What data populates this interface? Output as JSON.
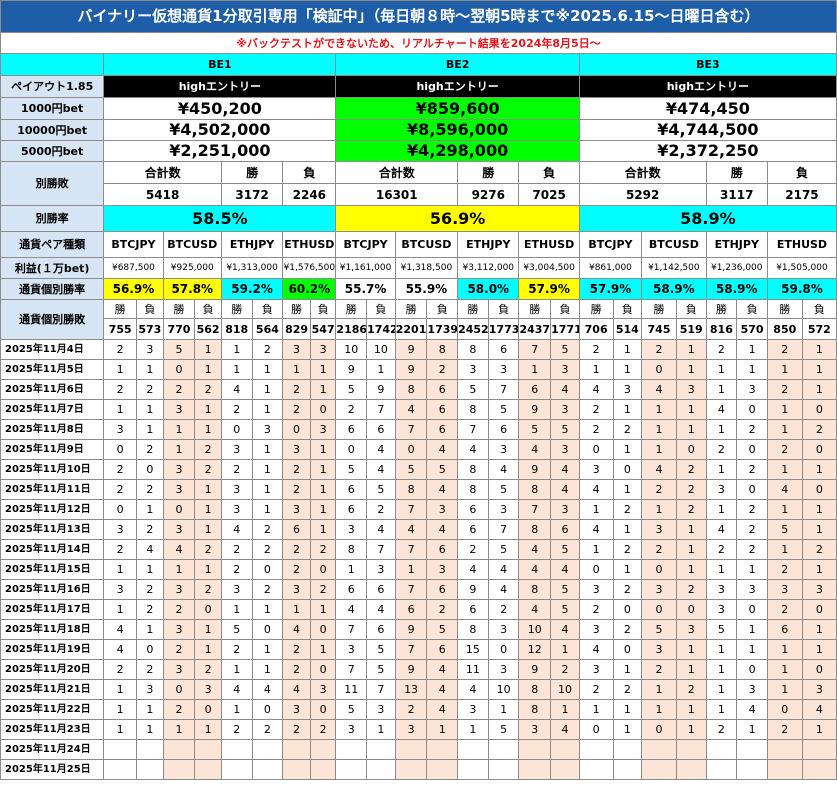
{
  "title": "バイナリー仮想通貨1分取引専用「検証中」（毎日朝８時〜翌朝5時まで※2025.6.15〜日曜日含む）",
  "subtitle": "※バックテストができないため、リアルチャート結果を2024年8月5日〜",
  "payout_label": "ペイアウト1.85",
  "colors": {
    "title_bg": "#1e5ea8",
    "cyan": "#00ffff",
    "green": "#00ff00",
    "yellow": "#ffff00",
    "pink": "#fce4d6",
    "label_bg": "#d7e4f4",
    "subtitle_text": "#e8141b"
  },
  "groups": [
    {
      "name": "BE1",
      "entry": "highエントリー",
      "bet_1000": "¥450,200",
      "bet_10000": "¥4,502,000",
      "bet_5000": "¥2,251,000",
      "total_label": "合計数",
      "win_label": "勝",
      "loss_label": "負",
      "total": "5418",
      "wins": "3172",
      "losses": "2246",
      "rate": "58.5%",
      "pairs": [
        {
          "name": "BTCJPY",
          "profit": "¥687,500",
          "rate": "56.9%",
          "w": "755",
          "l": "573"
        },
        {
          "name": "BTCUSD",
          "profit": "¥925,000",
          "rate": "57.8%",
          "w": "770",
          "l": "562"
        },
        {
          "name": "ETHJPY",
          "profit": "¥1,313,000",
          "rate": "59.2%",
          "w": "818",
          "l": "564"
        },
        {
          "name": "ETHUSD",
          "profit": "¥1,576,500",
          "rate": "60.2%",
          "w": "829",
          "l": "547"
        }
      ]
    },
    {
      "name": "BE2",
      "entry": "highエントリー",
      "bet_1000": "¥859,600",
      "bet_10000": "¥8,596,000",
      "bet_5000": "¥4,298,000",
      "total_label": "合計数",
      "win_label": "勝",
      "loss_label": "負",
      "total": "16301",
      "wins": "9276",
      "losses": "7025",
      "rate": "56.9%",
      "pairs": [
        {
          "name": "BTCJPY",
          "profit": "¥1,161,000",
          "rate": "55.7%",
          "w": "2186",
          "l": "1742"
        },
        {
          "name": "BTCUSD",
          "profit": "¥1,318,500",
          "rate": "55.9%",
          "w": "2201",
          "l": "1739"
        },
        {
          "name": "ETHJPY",
          "profit": "¥3,112,000",
          "rate": "58.0%",
          "w": "2452",
          "l": "1773"
        },
        {
          "name": "ETHUSD",
          "profit": "¥3,004,500",
          "rate": "57.9%",
          "w": "2437",
          "l": "1771"
        }
      ]
    },
    {
      "name": "BE3",
      "entry": "highエントリー",
      "bet_1000": "¥474,450",
      "bet_10000": "¥4,744,500",
      "bet_5000": "¥2,372,250",
      "total_label": "合計数",
      "win_label": "勝",
      "loss_label": "負",
      "total": "5292",
      "wins": "3117",
      "losses": "2175",
      "rate": "58.9%",
      "pairs": [
        {
          "name": "BTCJPY",
          "profit": "¥861,000",
          "rate": "57.9%",
          "w": "706",
          "l": "514"
        },
        {
          "name": "BTCUSD",
          "profit": "¥1,142,500",
          "rate": "58.9%",
          "w": "745",
          "l": "519"
        },
        {
          "name": "ETHJPY",
          "profit": "¥1,236,000",
          "rate": "58.9%",
          "w": "816",
          "l": "570"
        },
        {
          "name": "ETHUSD",
          "profit": "¥1,505,000",
          "rate": "59.8%",
          "w": "850",
          "l": "572"
        }
      ]
    }
  ],
  "row_labels": {
    "bet_1000": "1000円bet",
    "bet_10000": "10000円bet",
    "bet_5000": "5000円bet",
    "winloss": "別勝敗",
    "rate": "別勝率",
    "pair_type": "通貨ペア種類",
    "profit": "利益(１万bet)",
    "pair_rate": "通貨個別勝率",
    "pair_winloss": "通貨個別勝敗"
  },
  "wl_header": {
    "win": "勝",
    "loss": "負"
  },
  "daily": [
    {
      "date": "2025年11月4日",
      "v": [
        "2",
        "3",
        "5",
        "1",
        "1",
        "2",
        "3",
        "3",
        "10",
        "10",
        "9",
        "8",
        "8",
        "6",
        "7",
        "5",
        "2",
        "1",
        "2",
        "1",
        "2",
        "1",
        "2",
        "1"
      ]
    },
    {
      "date": "2025年11月5日",
      "v": [
        "1",
        "1",
        "0",
        "1",
        "1",
        "1",
        "1",
        "1",
        "9",
        "1",
        "9",
        "2",
        "3",
        "3",
        "1",
        "3",
        "1",
        "1",
        "0",
        "1",
        "1",
        "1",
        "1",
        "1"
      ]
    },
    {
      "date": "2025年11月6日",
      "v": [
        "2",
        "2",
        "2",
        "2",
        "4",
        "1",
        "2",
        "1",
        "5",
        "9",
        "8",
        "6",
        "5",
        "7",
        "6",
        "4",
        "4",
        "3",
        "4",
        "3",
        "1",
        "3",
        "2",
        "1"
      ]
    },
    {
      "date": "2025年11月7日",
      "v": [
        "1",
        "1",
        "3",
        "1",
        "2",
        "1",
        "2",
        "0",
        "2",
        "7",
        "4",
        "6",
        "8",
        "5",
        "9",
        "3",
        "2",
        "1",
        "1",
        "1",
        "4",
        "0",
        "1",
        "0"
      ]
    },
    {
      "date": "2025年11月8日",
      "v": [
        "3",
        "1",
        "1",
        "1",
        "0",
        "3",
        "0",
        "3",
        "6",
        "6",
        "7",
        "6",
        "7",
        "6",
        "5",
        "5",
        "2",
        "2",
        "1",
        "1",
        "1",
        "2",
        "1",
        "2"
      ]
    },
    {
      "date": "2025年11月9日",
      "v": [
        "0",
        "2",
        "1",
        "2",
        "3",
        "1",
        "3",
        "1",
        "0",
        "4",
        "0",
        "4",
        "4",
        "3",
        "4",
        "3",
        "0",
        "1",
        "1",
        "0",
        "2",
        "0",
        "2",
        "0"
      ]
    },
    {
      "date": "2025年11月10日",
      "v": [
        "2",
        "0",
        "3",
        "2",
        "2",
        "1",
        "2",
        "1",
        "5",
        "4",
        "5",
        "5",
        "8",
        "4",
        "9",
        "4",
        "3",
        "0",
        "4",
        "2",
        "1",
        "2",
        "1",
        "1"
      ]
    },
    {
      "date": "2025年11月11日",
      "v": [
        "2",
        "2",
        "3",
        "1",
        "3",
        "1",
        "2",
        "1",
        "6",
        "5",
        "8",
        "4",
        "8",
        "5",
        "8",
        "4",
        "4",
        "1",
        "2",
        "2",
        "3",
        "0",
        "4",
        "0"
      ]
    },
    {
      "date": "2025年11月12日",
      "v": [
        "0",
        "1",
        "0",
        "1",
        "3",
        "1",
        "3",
        "1",
        "6",
        "2",
        "7",
        "3",
        "6",
        "3",
        "7",
        "3",
        "1",
        "2",
        "1",
        "2",
        "1",
        "2",
        "1",
        "1"
      ]
    },
    {
      "date": "2025年11月13日",
      "v": [
        "3",
        "2",
        "3",
        "1",
        "4",
        "2",
        "6",
        "1",
        "3",
        "4",
        "4",
        "4",
        "6",
        "7",
        "8",
        "6",
        "4",
        "1",
        "3",
        "1",
        "4",
        "2",
        "5",
        "1"
      ]
    },
    {
      "date": "2025年11月14日",
      "v": [
        "2",
        "4",
        "4",
        "2",
        "2",
        "2",
        "2",
        "2",
        "8",
        "7",
        "7",
        "6",
        "2",
        "5",
        "4",
        "5",
        "1",
        "2",
        "2",
        "1",
        "2",
        "2",
        "1",
        "2"
      ]
    },
    {
      "date": "2025年11月15日",
      "v": [
        "1",
        "1",
        "1",
        "1",
        "2",
        "0",
        "2",
        "0",
        "1",
        "3",
        "1",
        "3",
        "4",
        "4",
        "4",
        "4",
        "0",
        "1",
        "0",
        "1",
        "1",
        "1",
        "2",
        "1"
      ]
    },
    {
      "date": "2025年11月16日",
      "v": [
        "3",
        "2",
        "3",
        "2",
        "3",
        "2",
        "3",
        "2",
        "6",
        "6",
        "7",
        "6",
        "9",
        "4",
        "8",
        "5",
        "3",
        "2",
        "3",
        "2",
        "3",
        "3",
        "3",
        "3"
      ]
    },
    {
      "date": "2025年11月17日",
      "v": [
        "1",
        "2",
        "2",
        "0",
        "1",
        "1",
        "1",
        "1",
        "4",
        "4",
        "6",
        "2",
        "6",
        "2",
        "4",
        "5",
        "2",
        "0",
        "0",
        "0",
        "3",
        "0",
        "2",
        "0"
      ]
    },
    {
      "date": "2025年11月18日",
      "v": [
        "4",
        "1",
        "3",
        "1",
        "5",
        "0",
        "4",
        "0",
        "7",
        "6",
        "9",
        "5",
        "8",
        "3",
        "10",
        "4",
        "3",
        "2",
        "5",
        "3",
        "5",
        "1",
        "6",
        "1"
      ]
    },
    {
      "date": "2025年11月19日",
      "v": [
        "4",
        "0",
        "2",
        "1",
        "2",
        "1",
        "2",
        "1",
        "3",
        "5",
        "7",
        "6",
        "15",
        "0",
        "12",
        "1",
        "4",
        "0",
        "3",
        "1",
        "1",
        "1",
        "1",
        "1"
      ]
    },
    {
      "date": "2025年11月20日",
      "v": [
        "2",
        "2",
        "3",
        "2",
        "1",
        "1",
        "2",
        "0",
        "7",
        "5",
        "9",
        "4",
        "11",
        "3",
        "9",
        "2",
        "3",
        "1",
        "2",
        "1",
        "1",
        "0",
        "1",
        "0"
      ]
    },
    {
      "date": "2025年11月21日",
      "v": [
        "1",
        "3",
        "0",
        "3",
        "4",
        "4",
        "4",
        "3",
        "11",
        "7",
        "13",
        "4",
        "4",
        "10",
        "8",
        "10",
        "2",
        "2",
        "1",
        "2",
        "1",
        "3",
        "1",
        "3"
      ]
    },
    {
      "date": "2025年11月22日",
      "v": [
        "1",
        "1",
        "2",
        "0",
        "1",
        "0",
        "3",
        "0",
        "5",
        "3",
        "2",
        "4",
        "3",
        "1",
        "8",
        "1",
        "1",
        "1",
        "1",
        "1",
        "1",
        "4",
        "0",
        "4"
      ]
    },
    {
      "date": "2025年11月23日",
      "v": [
        "1",
        "1",
        "1",
        "1",
        "2",
        "2",
        "2",
        "2",
        "3",
        "1",
        "3",
        "1",
        "1",
        "5",
        "3",
        "4",
        "0",
        "1",
        "0",
        "1",
        "2",
        "1",
        "2",
        "1"
      ]
    },
    {
      "date": "2025年11月24日",
      "v": [
        "",
        "",
        "",
        "",
        "",
        "",
        "",
        "",
        "",
        "",
        "",
        "",
        "",
        "",
        "",
        "",
        "",
        "",
        "",
        "",
        "",
        "",
        "",
        ""
      ]
    },
    {
      "date": "2025年11月25日",
      "v": [
        "",
        "",
        "",
        "",
        "",
        "",
        "",
        "",
        "",
        "",
        "",
        "",
        "",
        "",
        "",
        "",
        "",
        "",
        "",
        "",
        "",
        "",
        "",
        ""
      ]
    }
  ]
}
